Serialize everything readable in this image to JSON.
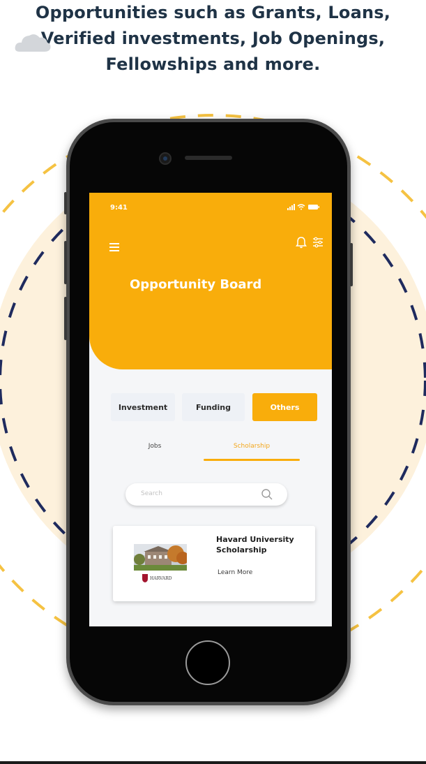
{
  "promo": {
    "headline_line1": "Opportunities such as Grants, Loans,",
    "headline_line2": "Verified investments, Job Openings,",
    "headline_line3": "Fellowships and more."
  },
  "colors": {
    "accent": "#f9ad0b",
    "navy": "#1f2b5e",
    "headline": "#1f3346",
    "circle_fill": "#fdf1dc"
  },
  "status_bar": {
    "time": "9:41",
    "icons": [
      "signal-icon",
      "wifi-icon",
      "battery-icon"
    ]
  },
  "app_header": {
    "title": "Opportunity Board",
    "left_icon": "menu-icon",
    "right_icons": [
      "bell-icon",
      "filter-icon"
    ]
  },
  "category_tabs": [
    {
      "label": "Investment",
      "active": false
    },
    {
      "label": "Funding",
      "active": false
    },
    {
      "label": "Others",
      "active": true
    }
  ],
  "sub_tabs": [
    {
      "label": "Jobs",
      "active": false
    },
    {
      "label": "Scholarship",
      "active": true
    }
  ],
  "search": {
    "placeholder": "Search",
    "icon": "search-icon"
  },
  "cards": [
    {
      "title": "Havard University Scholarship",
      "link_label": "Learn More",
      "logo_text": "HARVARD"
    }
  ]
}
